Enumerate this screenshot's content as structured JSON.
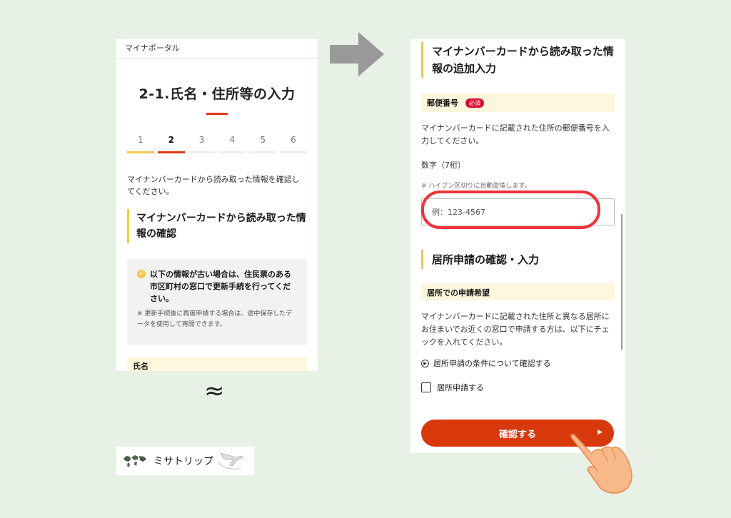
{
  "left": {
    "header": "マイナポータル",
    "title": "2-1.氏名・住所等の入力",
    "steps": [
      "1",
      "2",
      "3",
      "4",
      "5",
      "6"
    ],
    "intro": "マイナンバーカードから読み取った情報を確認してください。",
    "section_title": "マイナンバーカードから読み取った情報の確認",
    "notice_main": "以下の情報が古い場合は、住民票のある市区町村の窓口で更新手続を行ってください。",
    "notice_sub": "※ 更新手続後に再度申請する場合は、途中保存したデータを使用して再開できます。",
    "field_label": "氏名"
  },
  "approx_symbol": "≈",
  "logo_text": "ミサトリップ",
  "right": {
    "section_title": "マイナンバーカードから読み取った情報の追加入力",
    "postal_label": "郵便番号",
    "required_badge": "必須",
    "postal_desc": "マイナンバーカードに記載された住所の郵便番号を入力してください。",
    "postal_format": "数字（7桁）",
    "postal_note": "※ ハイフン区切りに自動変換します。",
    "postal_placeholder": "例：123-4567",
    "residence_title": "居所申請の確認・入力",
    "residence_field": "居所での申請希望",
    "residence_desc": "マイナンバーカードに記載された住所と異なる居所にお住まいでお近くの窓口で申請する方は、以下にチェックを入れてください。",
    "conditions_link": "居所申請の条件について確認する",
    "checkbox_label": "居所申請する",
    "confirm_button": "確認する"
  },
  "colors": {
    "accent_red": "#d8390c",
    "highlight_ring": "#f0323a",
    "accent_yellow": "#f2c94c",
    "field_bg": "#fdf7dd",
    "page_bg": "#e8f1e6"
  }
}
